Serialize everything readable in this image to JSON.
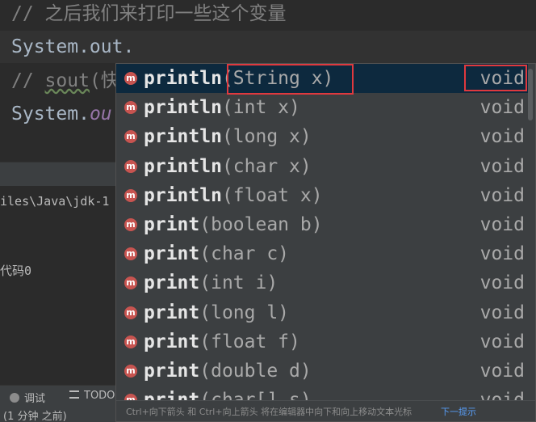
{
  "editor": {
    "line1": "// 之后我们来打印一些这个变量",
    "line2": "System.out.",
    "line3_prefix": "// ",
    "line3_sout": "sout",
    "line3_rest": "(快",
    "line4_prefix": "System.",
    "line4_member": "ou"
  },
  "run_panel": {
    "path_text": "iles\\Java\\jdk-1",
    "exit_text": "代码0"
  },
  "toolbar": {
    "debug_label": "调试",
    "todo_label": "TODO"
  },
  "status": {
    "text": "(1 分钟 之前)"
  },
  "completion": {
    "items": [
      {
        "name": "println",
        "params": "(String x)",
        "type": "void"
      },
      {
        "name": "println",
        "params": "(int x)",
        "type": "void"
      },
      {
        "name": "println",
        "params": "(long x)",
        "type": "void"
      },
      {
        "name": "println",
        "params": "(char x)",
        "type": "void"
      },
      {
        "name": "println",
        "params": "(float x)",
        "type": "void"
      },
      {
        "name": "print",
        "params": "(boolean b)",
        "type": "void"
      },
      {
        "name": "print",
        "params": "(char c)",
        "type": "void"
      },
      {
        "name": "print",
        "params": "(int i)",
        "type": "void"
      },
      {
        "name": "print",
        "params": "(long l)",
        "type": "void"
      },
      {
        "name": "print",
        "params": "(float f)",
        "type": "void"
      },
      {
        "name": "print",
        "params": "(double d)",
        "type": "void"
      },
      {
        "name": "print",
        "params": "(char[] s)",
        "type": "void"
      }
    ],
    "icon_letter": "m",
    "hint_text": "Ctrl+向下箭头 和 Ctrl+向上箭头 将在编辑器中向下和向上移动文本光标",
    "hint_link": "下一提示",
    "colors": {
      "selected_bg": "#0d293e",
      "method_icon": "#c75450",
      "highlight_box": "#e0393e"
    }
  }
}
